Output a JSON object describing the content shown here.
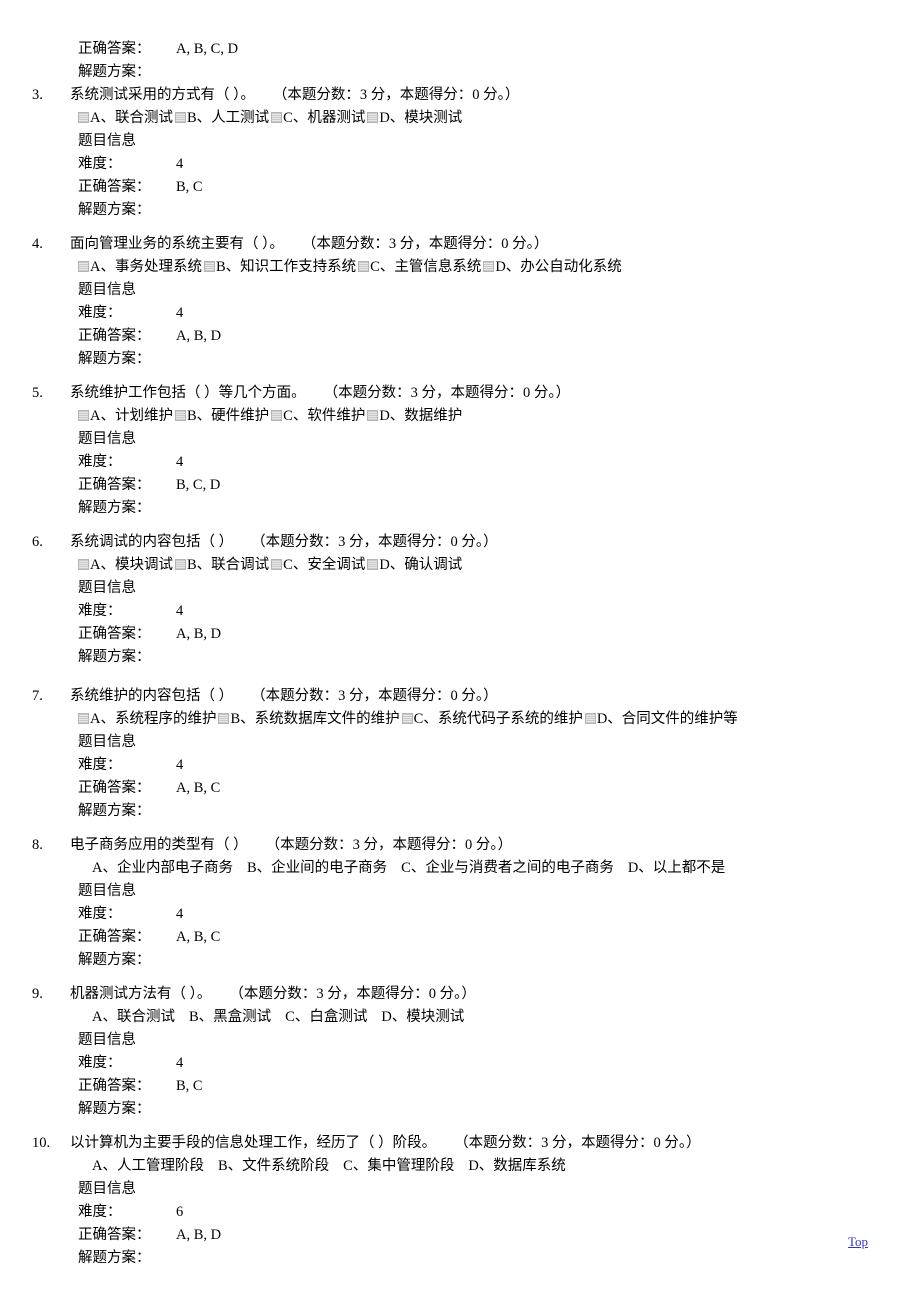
{
  "labels": {
    "info_title": "题目信息",
    "difficulty": "难度：",
    "correct_answer": "正确答案：",
    "solution": "解题方案：",
    "top_link": "Top"
  },
  "orphan_block": {
    "correct_answer_label": "正确答案：",
    "correct_answer_value": "A, B, C, D",
    "solution_label": "解题方案："
  },
  "questions": [
    {
      "number": "3.",
      "text": "系统测试采用的方式有（ ）。",
      "score": "（本题分数：3 分，本题得分：0 分。）",
      "option_style": "checkbox",
      "options": [
        "A、联合测试",
        "B、人工测试",
        "C、机器测试",
        "D、模块测试"
      ],
      "info_title": "题目信息",
      "difficulty_label": "难度：",
      "difficulty": "4",
      "answer_label": "正确答案：",
      "answer": "B, C",
      "solution_label": "解题方案："
    },
    {
      "number": "4.",
      "text": "面向管理业务的系统主要有（ ）。",
      "score": "（本题分数：3 分，本题得分：0 分。）",
      "option_style": "checkbox",
      "options": [
        "A、事务处理系统",
        "B、知识工作支持系统",
        "C、主管信息系统 ",
        "D、办公自动化系统"
      ],
      "info_title": "题目信息",
      "difficulty_label": "难度：",
      "difficulty": "4",
      "answer_label": "正确答案：",
      "answer": "A, B, D",
      "solution_label": "解题方案："
    },
    {
      "number": "5.",
      "text": "系统维护工作包括（ ）等几个方面。",
      "score": "（本题分数：3 分，本题得分：0 分。）",
      "option_style": "checkbox",
      "options": [
        "A、计划维护",
        "B、硬件维护",
        "C、软件维护",
        "D、数据维护"
      ],
      "info_title": "题目信息",
      "difficulty_label": "难度：",
      "difficulty": "4",
      "answer_label": "正确答案：",
      "answer": "B, C, D",
      "solution_label": "解题方案："
    },
    {
      "number": "6.",
      "text": "系统调试的内容包括（ ）",
      "score": "（本题分数：3 分，本题得分：0 分。）",
      "option_style": "checkbox",
      "options": [
        "A、模块调试",
        "B、联合调试",
        "C、安全调试",
        "D、确认调试"
      ],
      "info_title": "题目信息",
      "difficulty_label": "难度：",
      "difficulty": "4",
      "answer_label": "正确答案：",
      "answer": "A, B, D",
      "solution_label": "解题方案："
    },
    {
      "number": "7.",
      "text": "系统维护的内容包括（ ）",
      "score": "（本题分数：3 分，本题得分：0 分。）",
      "option_style": "checkbox",
      "options": [
        "A、系统程序的维护",
        "B、系统数据库文件的维护",
        "C、系统代码子系统的维护",
        "D、合同文件的维护等"
      ],
      "info_title": "题目信息",
      "difficulty_label": "难度：",
      "difficulty": "4",
      "answer_label": "正确答案：",
      "answer": "A, B, C",
      "solution_label": "解题方案："
    },
    {
      "number": "8.",
      "text": "电子商务应用的类型有（ ）",
      "score": "（本题分数：3 分，本题得分：0 分。）",
      "option_style": "plain",
      "options": [
        "A、企业内部电子商务",
        "B、企业间的电子商务",
        "C、企业与消费者之间的电子商务",
        "D、以上都不是"
      ],
      "info_title": "题目信息",
      "difficulty_label": "难度：",
      "difficulty": "4",
      "answer_label": "正确答案：",
      "answer": "A, B, C",
      "solution_label": "解题方案："
    },
    {
      "number": "9.",
      "text": "机器测试方法有（ ）。",
      "score": "（本题分数：3 分，本题得分：0 分。）",
      "option_style": "plain",
      "options": [
        "A、联合测试",
        "B、黑盒测试",
        "C、白盒测试",
        "D、模块测试"
      ],
      "info_title": "题目信息",
      "difficulty_label": "难度：",
      "difficulty": "4",
      "answer_label": "正确答案：",
      "answer": "B, C",
      "solution_label": "解题方案："
    },
    {
      "number": "10.",
      "text": "以计算机为主要手段的信息处理工作，经历了（ ）阶段。",
      "score": "（本题分数：3 分，本题得分：0 分。）",
      "option_style": "plain",
      "options": [
        "A、人工管理阶段",
        "B、文件系统阶段",
        "C、集中管理阶段",
        "D、数据库系统"
      ],
      "info_title": "题目信息",
      "difficulty_label": "难度：",
      "difficulty": "6",
      "answer_label": "正确答案：",
      "answer": "A, B, D",
      "solution_label": "解题方案："
    }
  ],
  "colors": {
    "link": "#3333cc",
    "text": "#000000",
    "checkbox_border": "#b4b4b4"
  }
}
